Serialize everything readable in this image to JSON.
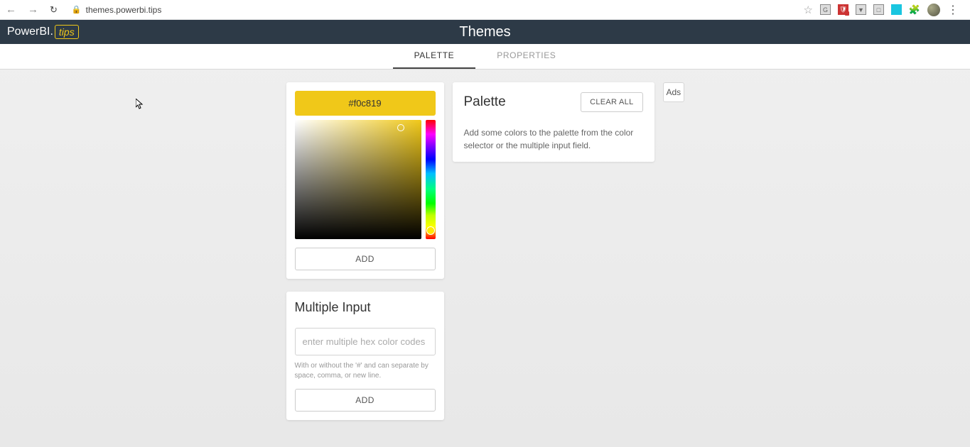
{
  "browser": {
    "url": "themes.powerbi.tips"
  },
  "header": {
    "logo_prefix": "PowerBI.",
    "logo_tips": "tips",
    "title": "Themes"
  },
  "tabs": {
    "palette": "PALETTE",
    "properties": "PROPERTIES"
  },
  "picker": {
    "hex": "#f0c819",
    "add": "ADD"
  },
  "multi": {
    "title": "Multiple Input",
    "placeholder": "enter multiple hex color codes",
    "hint": "With or without the '#' and can separate by space, comma, or new line.",
    "add": "ADD"
  },
  "palette": {
    "title": "Palette",
    "clear": "CLEAR ALL",
    "empty": "Add some colors to the palette from the color selector or the multiple input field."
  },
  "ads": {
    "label": "Ads"
  }
}
